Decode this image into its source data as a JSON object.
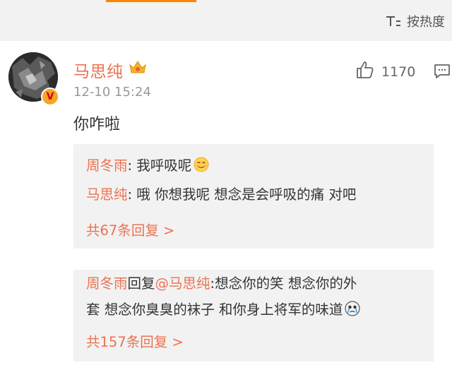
{
  "header": {
    "sort_label": "按热度",
    "sort_icon": "sort-icon",
    "accent_color": "#ff8200"
  },
  "comment": {
    "username": "马思纯",
    "timestamp": "12-10 15:24",
    "like_count": "1170",
    "text": "你咋啦",
    "name_color": "#eb7350",
    "avatar_badge": "V"
  },
  "reply_threads": [
    {
      "lines": [
        {
          "name": "周冬雨",
          "text": ": 我呼吸呢",
          "emoji": "smile-emoji"
        },
        {
          "name": "马思纯",
          "text": ": 哦 你想我呢 想念是会呼吸的痛 对吧"
        }
      ],
      "more_label": "共67条回复 >"
    },
    {
      "lines": [
        {
          "name": "周冬雨",
          "text_pre": "回复",
          "mention": "@马思纯",
          "text": ":想念你的笑 想念你的外"
        },
        {
          "text": "套 想念你臭臭的袜子 和你身上将军的味道",
          "emoji": "crying-emoji"
        }
      ],
      "more_label": "共157条回复 >"
    }
  ]
}
